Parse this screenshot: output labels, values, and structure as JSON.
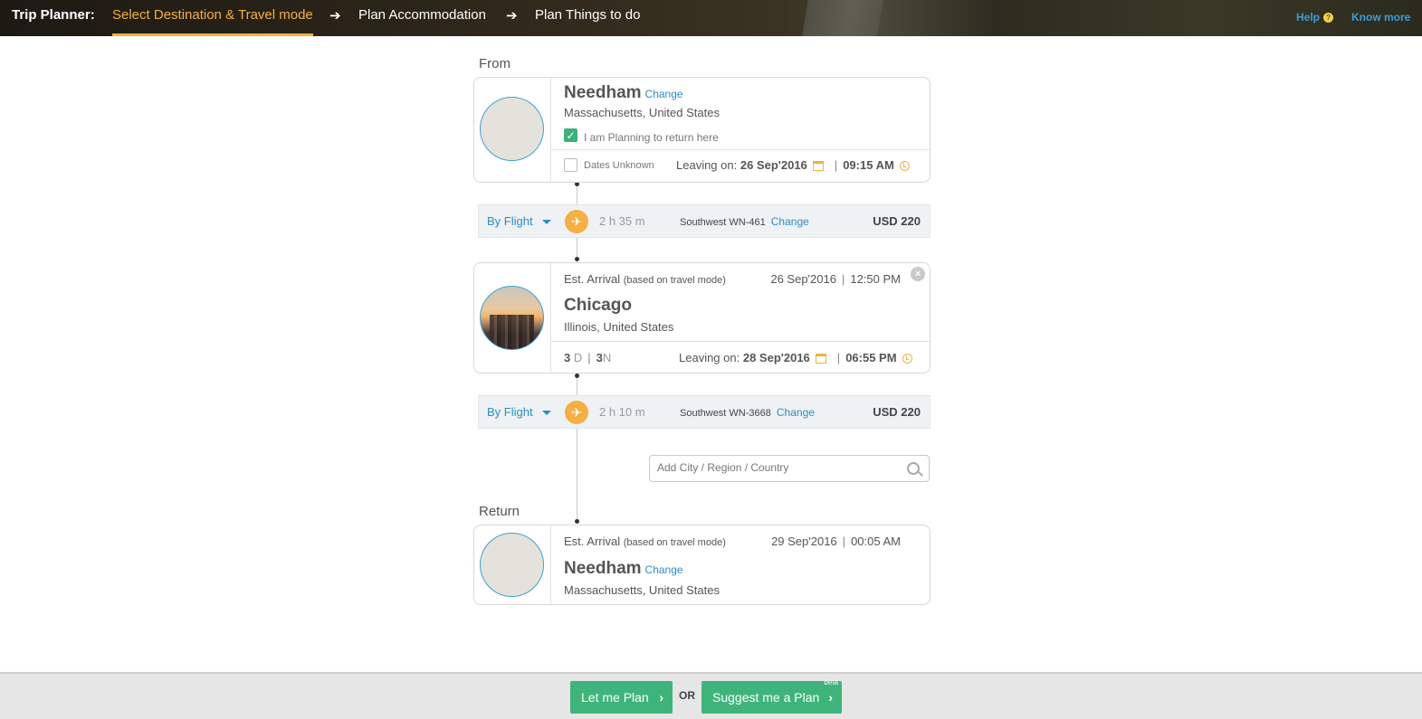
{
  "header": {
    "brand": "Trip Planner:",
    "steps": [
      {
        "label": "Select Destination & Travel mode"
      },
      {
        "label": "Plan Accommodation"
      },
      {
        "label": "Plan Things to do"
      }
    ],
    "arrow": "➔",
    "help": "Help",
    "know_more": "Know more"
  },
  "from": {
    "section_label": "From",
    "city": "Needham",
    "change": "Change",
    "region": "Massachusetts, United States",
    "return_checkbox_label": "I am Planning to return here",
    "return_checked": true,
    "dates_unknown_label": "Dates Unknown",
    "leaving_label": "Leaving on:",
    "leaving_date": "26 Sep'2016",
    "leaving_time": "09:15 AM"
  },
  "leg1": {
    "mode": "By Flight",
    "duration": "2 h 35 m",
    "flight": "Southwest WN-461",
    "change": "Change",
    "price": "USD 220"
  },
  "stop": {
    "est_label": "Est. Arrival",
    "est_note": "(based on travel mode)",
    "arrival_date": "26 Sep'2016",
    "arrival_time": "12:50 PM",
    "city": "Chicago",
    "region": "Illinois, United States",
    "days": "3",
    "days_unit": "D",
    "nights": "3",
    "nights_unit": "N",
    "leaving_label": "Leaving on:",
    "leaving_date": "28 Sep'2016",
    "leaving_time": "06:55 PM"
  },
  "leg2": {
    "mode": "By Flight",
    "duration": "2 h 10 m",
    "flight": "Southwest WN-3668",
    "change": "Change",
    "price": "USD 220"
  },
  "add_city": {
    "placeholder": "Add City / Region / Country"
  },
  "return": {
    "section_label": "Return",
    "est_label": "Est. Arrival",
    "est_note": "(based on travel mode)",
    "arrival_date": "29 Sep'2016",
    "arrival_time": "00:05 AM",
    "city": "Needham",
    "change": "Change",
    "region": "Massachusetts, United States"
  },
  "footer": {
    "let_me_plan": "Let me Plan",
    "or": "OR",
    "suggest": "Suggest me a Plan",
    "beta": "beta"
  },
  "colors": {
    "accent_orange": "#f5b041",
    "link_blue": "#2a8fc4",
    "button_green": "#3fb47a"
  }
}
